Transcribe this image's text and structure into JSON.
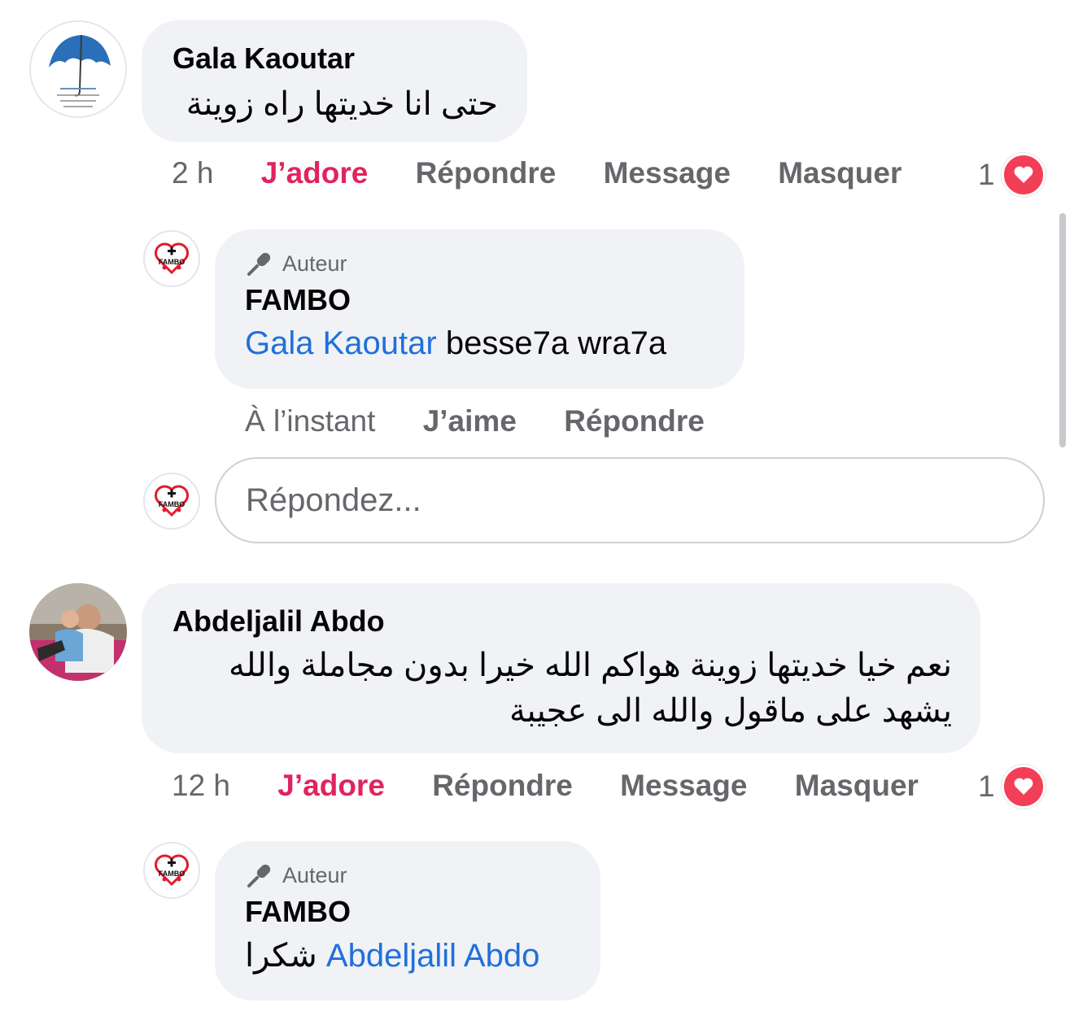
{
  "comments": [
    {
      "author": "Gala Kaoutar",
      "text": "حتى انا خديتها راه زوينة",
      "time": "2 h",
      "like_label": "J’adore",
      "reply_label": "Répondre",
      "message_label": "Message",
      "hide_label": "Masquer",
      "reaction_count": "1",
      "reply": {
        "badge": "Auteur",
        "author": "FAMBO",
        "mention": "Gala Kaoutar",
        "text": "besse7a wra7a",
        "time": "À l’instant",
        "like_label": "J’aime",
        "reply_label": "Répondre"
      },
      "reply_placeholder": "Répondez..."
    },
    {
      "author": "Abdeljalil Abdo",
      "text_line1": "نعم خيا خديتها زوينة هواكم الله خيرا بدون مجاملة والله",
      "text_line2": "يشهد على ماقول والله الى عجيبة",
      "time": "12 h",
      "like_label": "J’adore",
      "reply_label": "Répondre",
      "message_label": "Message",
      "hide_label": "Masquer",
      "reaction_count": "1",
      "reply": {
        "badge": "Auteur",
        "author": "FAMBO",
        "text": "شكرا",
        "mention": "Abdeljalil Abdo"
      }
    }
  ],
  "page_logo_text": "FAMBO",
  "colors": {
    "accent_link": "#216fdb",
    "love": "#f33e58",
    "bubble": "#f0f2f5",
    "meta": "#65676b"
  }
}
